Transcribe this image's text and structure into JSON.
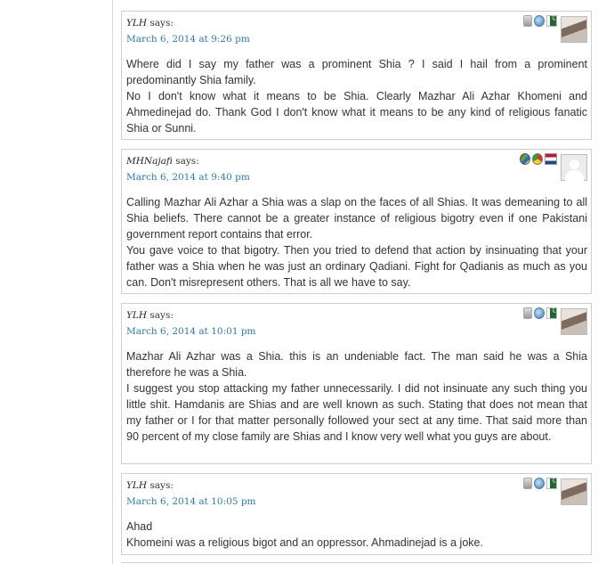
{
  "comments": [
    {
      "author": "YLH",
      "says": "says:",
      "date": "March 6, 2014 at 9:26 pm",
      "paragraphs": [
        "Where did I say my father was a prominent Shia ? I said I hail from a prominent predominantly Shia family.",
        "No I don't know what it means to be Shia. Clearly Mazhar Ali Azhar Khomeni and Ahmedinejad do. Thank God I don't know what it means to be any kind of religious fanatic Shia or Sunni."
      ],
      "badges": [
        "device-icon",
        "browser-icon",
        "flag-pakistan-icon"
      ],
      "avatar": "photo"
    },
    {
      "author": "MHNajafi",
      "says": "says:",
      "date": "March 6, 2014 at 9:40 pm",
      "paragraphs": [
        "Calling Mazhar Ali Azhar a Shia was a slap on the faces of all Shias. It was demeaning to all Shia beliefs. There cannot be a greater instance of religious bigotry even if one Pakistani government report contains that error.",
        "You gave voice to that bigotry. Then you tried to defend that action by insinuating that your father was a Shia when he was just an ordinary Qadiani. Fight for Qadianis as much as you can. Don't misrepresent others. That is all we have to say."
      ],
      "badges": [
        "windows-icon",
        "chrome-icon",
        "flag-netherlands-icon"
      ],
      "avatar": "default"
    },
    {
      "author": "YLH",
      "says": "says:",
      "date": "March 6, 2014 at 10:01 pm",
      "paragraphs": [
        "Mazhar Ali Azhar was a Shia. this is an undeniable fact. The man said he was a Shia therefore he was a Shia.",
        "I suggest you stop attacking my father unnecessarily. I did not insinuate any such thing you little shit. Hamdanis are Shias and are well known as such. Stating that does not mean that my father or I for that matter personally followed your sect at any time. That said more than 90 percent of my close family are Shias and I know very well what you guys are about."
      ],
      "badges": [
        "device-icon",
        "browser-icon",
        "flag-pakistan-icon"
      ],
      "avatar": "photo"
    },
    {
      "author": "YLH",
      "says": "says:",
      "date": "March 6, 2014 at 10:05 pm",
      "paragraphs": [
        "Ahad",
        "Khomeini was a religious bigot and an oppressor. Ahmadinejad is a joke."
      ],
      "badges": [
        "device-icon",
        "browser-icon",
        "flag-pakistan-icon"
      ],
      "avatar": "photo"
    }
  ]
}
